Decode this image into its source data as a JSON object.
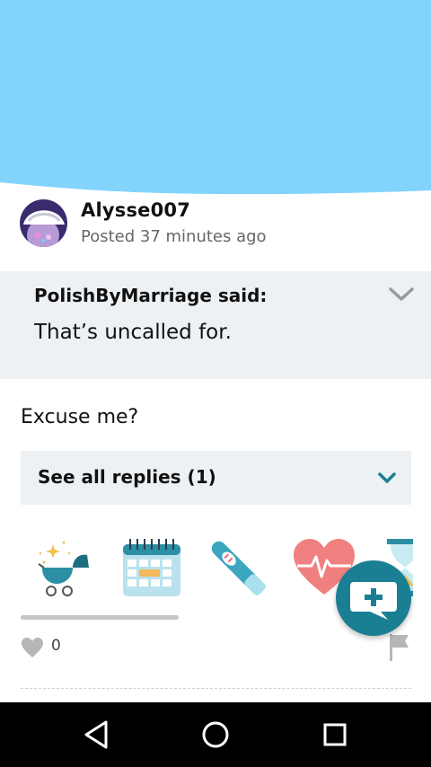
{
  "colors": {
    "hero": "#82d4fc",
    "accent": "#1a7f93",
    "panel": "#eef1f4",
    "navbar": "#000000"
  },
  "post": {
    "username": "Alysse007",
    "timestamp": "Posted 37 minutes ago"
  },
  "quote": {
    "author_line": "PolishByMarriage said:",
    "text": "That’s uncalled for."
  },
  "reply": {
    "text": "Excuse me?"
  },
  "replies": {
    "label": "See all replies (1)"
  },
  "stickers": [
    {
      "icon": "baby-stroller-icon"
    },
    {
      "icon": "calendar-icon"
    },
    {
      "icon": "pregnancy-test-icon"
    },
    {
      "icon": "heartbeat-icon"
    },
    {
      "icon": "hourglass-icon"
    }
  ],
  "likes": {
    "count": "0",
    "icon": "heart-icon"
  },
  "fab": {
    "icon": "add-comment-icon"
  },
  "navbar": {
    "buttons": [
      "back-icon",
      "home-icon",
      "recents-icon"
    ]
  }
}
